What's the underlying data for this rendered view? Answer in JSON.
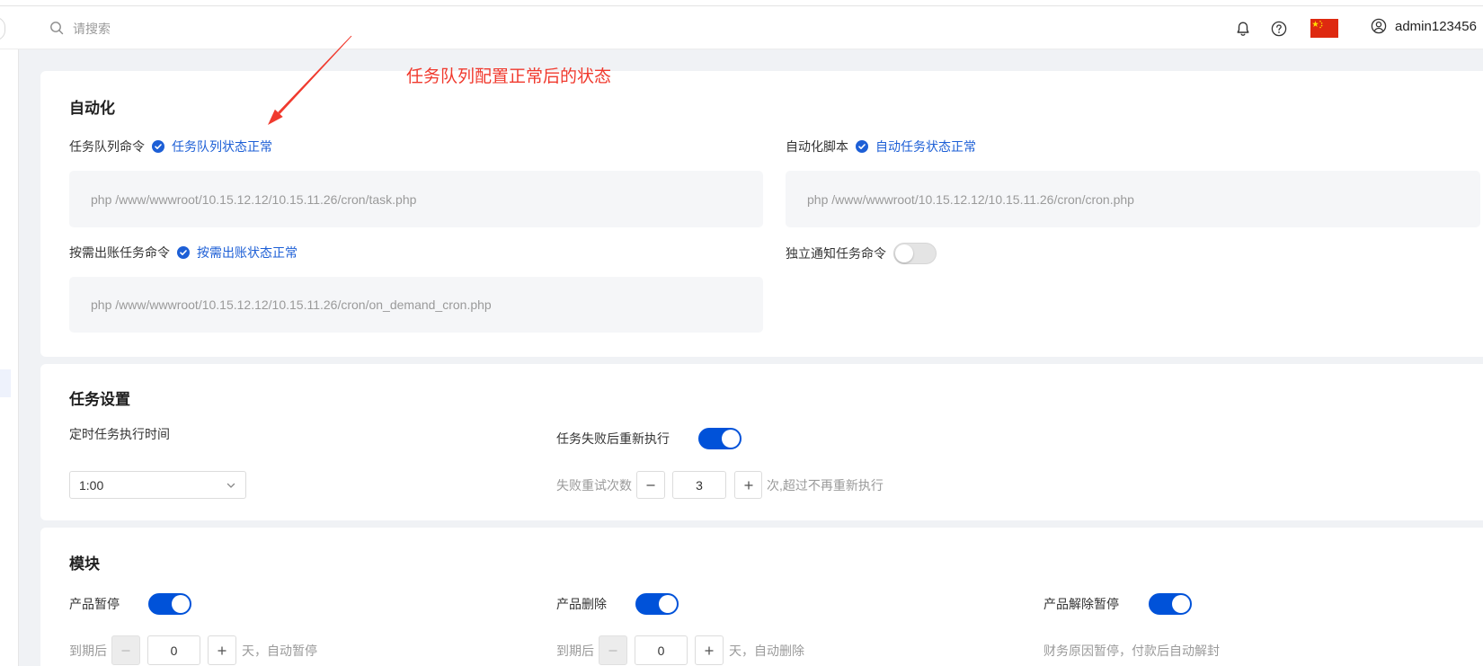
{
  "header": {
    "search": {
      "placeholder": "请搜索",
      "icon": "search-icon"
    },
    "notification_icon": "bell-icon",
    "help_icon": "help-icon",
    "language_icon": "china-flag-icon",
    "user_icon": "user-icon",
    "username": "admin123456"
  },
  "annotation": {
    "text": "任务队列配置正常后的状态"
  },
  "colors": {
    "accent": "#0052d9",
    "status": "#1d5fd6",
    "annotation": "#f03a2e",
    "page_bg": "#f0f2f5",
    "muted_text": "#9a9a9a"
  },
  "automation": {
    "title": "自动化",
    "queue_command": {
      "label": "任务队列命令",
      "status": "任务队列状态正常",
      "status_icon": "check-circle-icon",
      "value": "php /www/wwwroot/10.15.12.12/10.15.11.26/cron/task.php"
    },
    "automation_script": {
      "label": "自动化脚本",
      "status": "自动任务状态正常",
      "status_icon": "check-circle-icon",
      "value": "php /www/wwwroot/10.15.12.12/10.15.11.26/cron/cron.php"
    },
    "on_demand_command": {
      "label": "按需出账任务命令",
      "status": "按需出账状态正常",
      "status_icon": "check-circle-icon",
      "value": "php /www/wwwroot/10.15.12.12/10.15.11.26/cron/on_demand_cron.php"
    },
    "notify_command": {
      "label": "独立通知任务命令",
      "enabled": false
    }
  },
  "task_settings": {
    "title": "任务设置",
    "schedule": {
      "label": "定时任务执行时间",
      "value": "1:00"
    },
    "retry": {
      "label": "任务失败后重新执行",
      "enabled": true,
      "count_label": "失败重试次数",
      "count": "3",
      "count_suffix": "次,超过不再重新执行"
    }
  },
  "modules": {
    "title": "模块",
    "product_suspend": {
      "label": "产品暂停",
      "enabled": true,
      "prefix": "到期后",
      "days": "0",
      "suffix": "天，自动暂停",
      "decrement_disabled": true
    },
    "product_delete": {
      "label": "产品删除",
      "enabled": true,
      "prefix": "到期后",
      "days": "0",
      "suffix": "天，自动删除",
      "decrement_disabled": true
    },
    "product_unsuspend": {
      "label": "产品解除暂停",
      "enabled": true,
      "note": "财务原因暂停，付款后自动解封"
    }
  }
}
